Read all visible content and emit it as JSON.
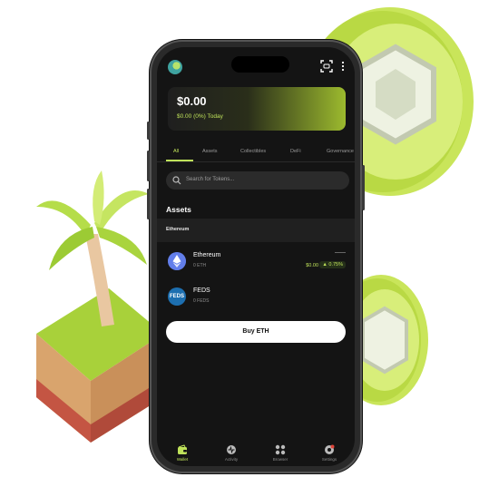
{
  "wallet": {
    "balance": "$0.00",
    "balance_change": "$0.00 (0%) Today"
  },
  "tabs": [
    {
      "label": "All"
    },
    {
      "label": "Assets"
    },
    {
      "label": "Collectibles"
    },
    {
      "label": "DeFi"
    },
    {
      "label": "Governance"
    }
  ],
  "search": {
    "placeholder": "Search for Tokens..."
  },
  "assets_section": {
    "title": "Assets",
    "network": "Ethereum",
    "items": [
      {
        "name": "Ethereum",
        "amount": "0 ETH",
        "dash": "——",
        "fiat": "$0.00",
        "change": "▲ 0.75%"
      },
      {
        "name": "FEDS",
        "amount": "0 FEDS",
        "icon_text": "FEDS"
      }
    ]
  },
  "buy_button": {
    "label": "Buy ETH"
  },
  "bottom_nav": [
    {
      "label": "Wallet"
    },
    {
      "label": "Activity"
    },
    {
      "label": "Browser"
    },
    {
      "label": "Settings"
    }
  ],
  "colors": {
    "accent": "#bfe25a",
    "background": "#141414"
  },
  "icons": {
    "scan": "scan-icon",
    "more": "more-icon",
    "search": "search-icon"
  }
}
